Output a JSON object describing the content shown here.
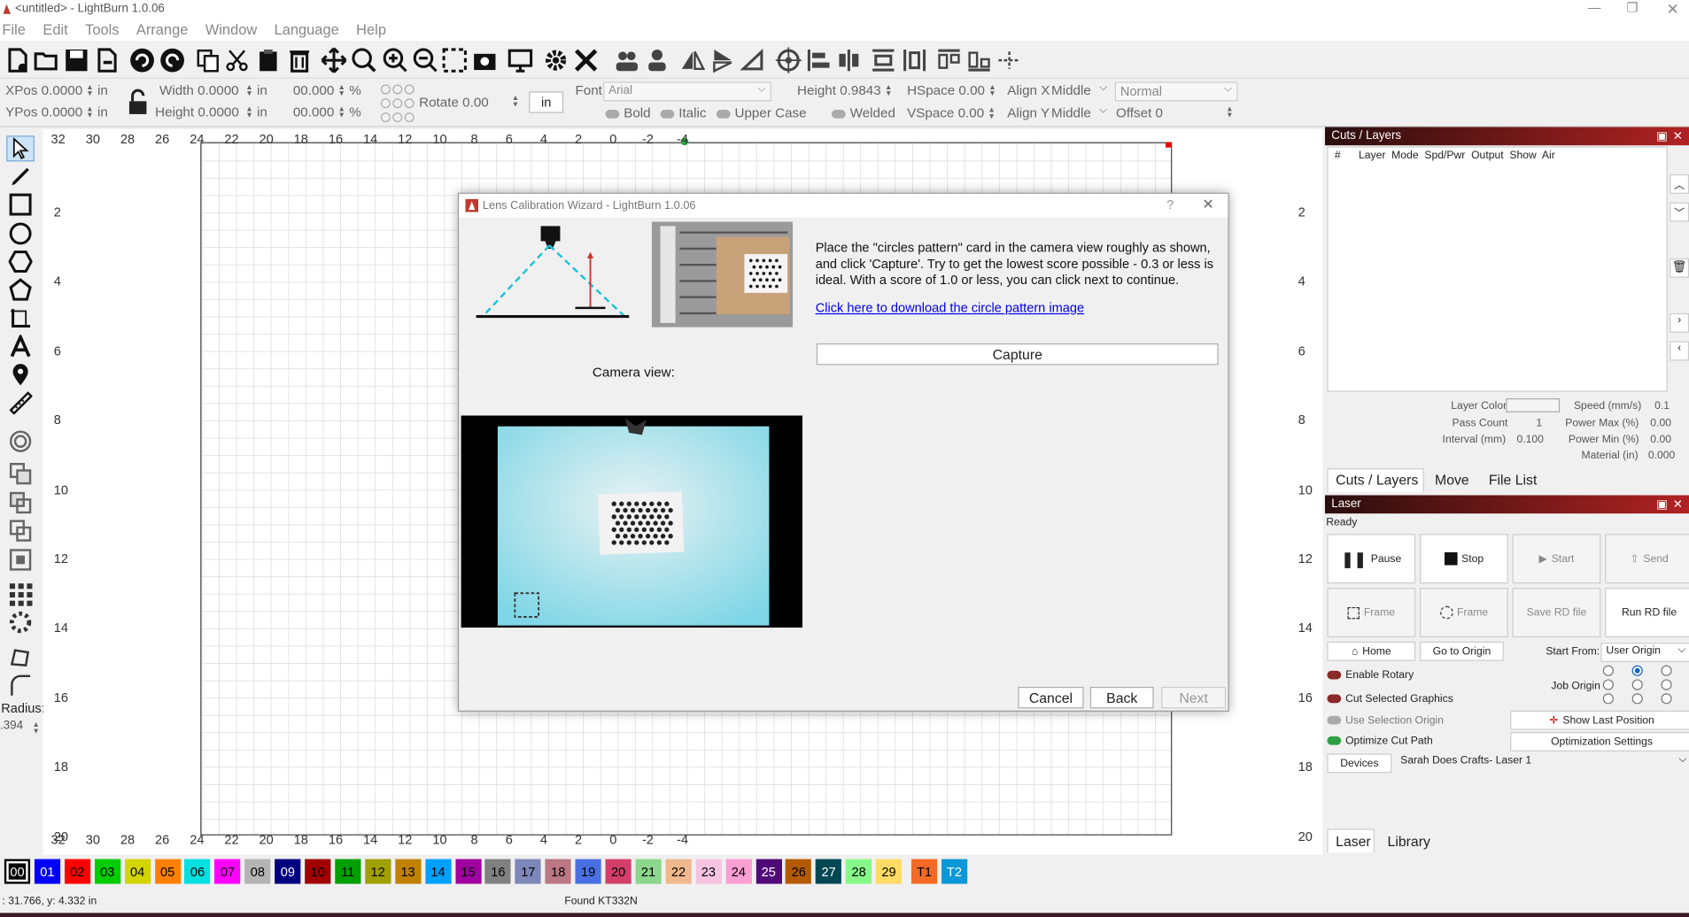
{
  "window": {
    "title": "<untitled> - LightBurn 1.0.06"
  },
  "menu": [
    "File",
    "Edit",
    "Tools",
    "Arrange",
    "Window",
    "Language",
    "Help"
  ],
  "props": {
    "xpos_label": "XPos",
    "xpos": "0.0000",
    "ypos_label": "YPos",
    "ypos": "0.0000",
    "unit_in": "in",
    "width_label": "Width",
    "width": "0.0000",
    "height_label": "Height",
    "height": "0.0000",
    "pct_w": "00.000",
    "pct_h": "00.000",
    "pct": "%",
    "rotate_label": "Rotate",
    "rotate": "0.00",
    "unit_btn": "in",
    "font_label": "Font",
    "font": "Arial",
    "text_height_label": "Height",
    "text_height": "0.9843",
    "hspace_label": "HSpace",
    "hspace": "0.00",
    "vspace_label": "VSpace",
    "vspace": "0.00",
    "alignx_label": "Align X",
    "alignx": "Middle",
    "aligny_label": "Align Y",
    "aligny": "Middle",
    "mode": "Normal",
    "offset_label": "Offset",
    "offset": "0",
    "bold": "Bold",
    "italic": "Italic",
    "upper": "Upper Case",
    "welded": "Welded"
  },
  "left_tools": {
    "radius_label": "Radius:",
    "radius": ".394"
  },
  "ruler": {
    "x": [
      "32",
      "30",
      "28",
      "26",
      "24",
      "22",
      "20",
      "18",
      "16",
      "14",
      "12",
      "10",
      "8",
      "6",
      "4",
      "2",
      "0",
      "-2",
      "-4"
    ],
    "y": [
      "2",
      "4",
      "6",
      "8",
      "10",
      "12",
      "14",
      "16",
      "18",
      "20"
    ]
  },
  "cuts": {
    "title": "Cuts / Layers",
    "cols": [
      "#",
      "Layer",
      "Mode",
      "Spd/Pwr",
      "Output",
      "Show",
      "Air"
    ],
    "layer_color": "Layer Color",
    "speed_label": "Speed (mm/s)",
    "speed": "0.1",
    "pass_label": "Pass Count",
    "pass": "1",
    "pmax_label": "Power Max (%)",
    "pmax": "0.00",
    "interval_label": "Interval (mm)",
    "interval": "0.100",
    "pmin_label": "Power Min (%)",
    "pmin": "0.00",
    "material_label": "Material (in)",
    "material": "0.000",
    "tabs": [
      "Cuts / Layers",
      "Move",
      "File List"
    ]
  },
  "laser": {
    "title": "Laser",
    "status": "Ready",
    "pause": "Pause",
    "stop": "Stop",
    "start": "Start",
    "send": "Send",
    "frame1": "Frame",
    "frame2": "Frame",
    "save_rd": "Save RD file",
    "run_rd": "Run RD file",
    "home": "Home",
    "origin": "Go to Origin",
    "start_from_label": "Start From:",
    "start_from": "User Origin",
    "job_origin": "Job Origin",
    "rotary": "Enable Rotary",
    "cut_sel": "Cut Selected Graphics",
    "use_sel": "Use Selection Origin",
    "show_last": "Show Last Position",
    "optimize": "Optimize Cut Path",
    "opt_settings": "Optimization Settings",
    "devices": "Devices",
    "device": "Sarah Does Crafts- Laser 1",
    "tabs": [
      "Laser",
      "Library"
    ]
  },
  "palette": [
    {
      "l": "00",
      "c": "#000000",
      "t": "#ffffff"
    },
    {
      "l": "01",
      "c": "#0000ff",
      "t": "#ffffff"
    },
    {
      "l": "02",
      "c": "#ff0000",
      "t": "#000"
    },
    {
      "l": "03",
      "c": "#00cc00",
      "t": "#000"
    },
    {
      "l": "04",
      "c": "#d4d400",
      "t": "#000"
    },
    {
      "l": "05",
      "c": "#ff8000",
      "t": "#000"
    },
    {
      "l": "06",
      "c": "#00e0e0",
      "t": "#000"
    },
    {
      "l": "07",
      "c": "#ff00ff",
      "t": "#000"
    },
    {
      "l": "08",
      "c": "#b4b4b4",
      "t": "#000"
    },
    {
      "l": "09",
      "c": "#000080",
      "t": "#ffffff"
    },
    {
      "l": "10",
      "c": "#a00000",
      "t": "#000"
    },
    {
      "l": "11",
      "c": "#00a000",
      "t": "#000"
    },
    {
      "l": "12",
      "c": "#a0a000",
      "t": "#000"
    },
    {
      "l": "13",
      "c": "#c08000",
      "t": "#000"
    },
    {
      "l": "14",
      "c": "#00a0ff",
      "t": "#000"
    },
    {
      "l": "15",
      "c": "#a000a0",
      "t": "#000"
    },
    {
      "l": "16",
      "c": "#808080",
      "t": "#000"
    },
    {
      "l": "17",
      "c": "#7d87b9",
      "t": "#000"
    },
    {
      "l": "18",
      "c": "#bb7784",
      "t": "#000"
    },
    {
      "l": "19",
      "c": "#4a6fe3",
      "t": "#000"
    },
    {
      "l": "20",
      "c": "#d33f6a",
      "t": "#000"
    },
    {
      "l": "21",
      "c": "#8cd78c",
      "t": "#000"
    },
    {
      "l": "22",
      "c": "#f0b98d",
      "t": "#000"
    },
    {
      "l": "23",
      "c": "#f6c4e1",
      "t": "#000"
    },
    {
      "l": "24",
      "c": "#fa9ed4",
      "t": "#000"
    },
    {
      "l": "25",
      "c": "#500a78",
      "t": "#ffffff"
    },
    {
      "l": "26",
      "c": "#b45a00",
      "t": "#000"
    },
    {
      "l": "27",
      "c": "#004754",
      "t": "#ffffff"
    },
    {
      "l": "28",
      "c": "#86fa88",
      "t": "#000"
    },
    {
      "l": "29",
      "c": "#ffdb66",
      "t": "#000"
    },
    {
      "l": "T1",
      "c": "#f36926",
      "t": "#000"
    },
    {
      "l": "T2",
      "c": "#0c98d7",
      "t": "#ffffff"
    }
  ],
  "status": {
    "coords": ": 31.766, y: 4.332 in",
    "device": "Found KT332N"
  },
  "dialog": {
    "title": "Lens Calibration Wizard - LightBurn 1.0.06",
    "instructions": "Place the \"circles pattern\" card in the camera view roughly as shown, and click 'Capture'.  Try to get the lowest score possible - 0.3 or less is ideal.  With a score of 1.0 or less, you can click next to continue.",
    "link": "Click here to download the circle pattern image",
    "capture": "Capture",
    "camera_label": "Camera view:",
    "cancel": "Cancel",
    "back": "Back",
    "next": "Next"
  }
}
